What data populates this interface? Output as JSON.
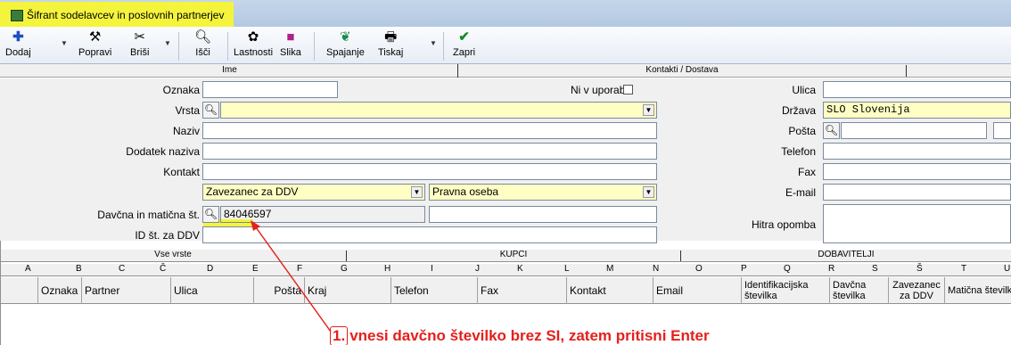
{
  "window": {
    "title": "Šifrant sodelavcev in poslovnih partnerjev"
  },
  "toolbar": {
    "dodaj": "Dodaj",
    "popravi": "Popravi",
    "brisi": "Briši",
    "isci": "Išči",
    "lastnosti": "Lastnosti",
    "slika": "Slika",
    "spajanje": "Spajanje",
    "tiskaj": "Tiskaj",
    "zapri": "Zapri"
  },
  "bands": {
    "ime": "Ime",
    "kontakti": "Kontakti / Dostava"
  },
  "form": {
    "oznaka_label": "Oznaka",
    "oznaka_value": "",
    "ni_v_uporabi_label": "Ni v uporabi",
    "vrsta_label": "Vrsta",
    "vrsta_value": "",
    "naziv_label": "Naziv",
    "naziv_value": "",
    "dodatek_label": "Dodatek naziva",
    "dodatek_value": "",
    "kontakt_label": "Kontakt",
    "kontakt_value": "",
    "zavezanec_value": "Zavezanec za DDV",
    "oseba_value": "Pravna oseba",
    "davcna_label": "Davčna in matična št.",
    "davcna_value": "84046597",
    "maticna_value": "",
    "id_ddv_label": "ID št. za DDV",
    "id_ddv_value": "",
    "ulica_label": "Ulica",
    "ulica_value": "",
    "drzava_label": "Država",
    "drzava_value": "SLO  Slovenija",
    "posta_label": "Pošta",
    "posta_value": "",
    "telefon_label": "Telefon",
    "telefon_value": "",
    "fax_label": "Fax",
    "fax_value": "",
    "email_label": "E-mail",
    "email_value": "",
    "hitra_label": "Hitra opomba",
    "hitra_value": ""
  },
  "grid": {
    "tabs": {
      "vse": "Vse vrste",
      "kupci": "KUPCI",
      "dobavitelji": "DOBAVITELJI"
    },
    "letters": [
      "A",
      "B",
      "C",
      "Č",
      "D",
      "E",
      "F",
      "G",
      "H",
      "I",
      "J",
      "K",
      "L",
      "M",
      "N",
      "O",
      "P",
      "Q",
      "R",
      "S",
      "Š",
      "T",
      "U"
    ],
    "columns": {
      "oznaka": "Oznaka",
      "partner": "Partner",
      "ulica": "Ulica",
      "posta": "Pošta",
      "kraj": "Kraj",
      "telefon": "Telefon",
      "fax": "Fax",
      "kontakt": "Kontakt",
      "email": "Email",
      "identifikacijska": "Identifikacijska številka",
      "davcna": "Davčna številka",
      "zavezanec": "Zavezanec za DDV",
      "maticna": "Matična številka"
    }
  },
  "annotation": {
    "number": "1.",
    "text": "vnesi davčno številko brez SI, zatem pritisni Enter"
  },
  "colors": {
    "highlight": "#f4f43c",
    "annotation": "#e4201c",
    "field_yellow": "#ffffc4"
  }
}
